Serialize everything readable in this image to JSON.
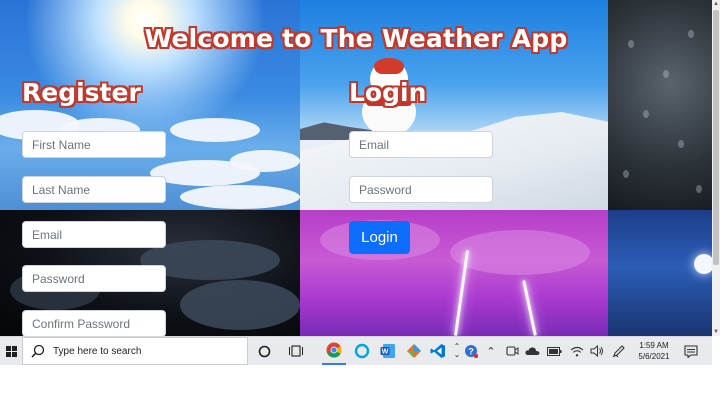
{
  "page": {
    "title": "Welcome to The Weather App"
  },
  "register": {
    "heading": "Register",
    "first_name_placeholder": "First Name",
    "last_name_placeholder": "Last Name",
    "email_placeholder": "Email",
    "password_placeholder": "Password",
    "confirm_password_placeholder": "Confirm Password"
  },
  "login": {
    "heading": "Login",
    "email_placeholder": "Email",
    "password_placeholder": "Password",
    "button_label": "Login"
  },
  "colors": {
    "heading_outline": "#c0392b",
    "login_button": "#0d6efd",
    "taskbar": "#e9eaee"
  },
  "taskbar": {
    "search_placeholder": "Type here to search",
    "apps": [
      "chrome-icon",
      "alexa-icon",
      "word-icon",
      "fusion-icon",
      "vscode-icon"
    ],
    "tray_icons": [
      "help-icon",
      "chevron-up-icon",
      "meet-now-icon",
      "onedrive-icon",
      "battery-icon",
      "wifi-icon",
      "volume-icon",
      "pen-icon"
    ],
    "clock": {
      "time": "1:59 AM",
      "date": "5/6/2021"
    }
  }
}
